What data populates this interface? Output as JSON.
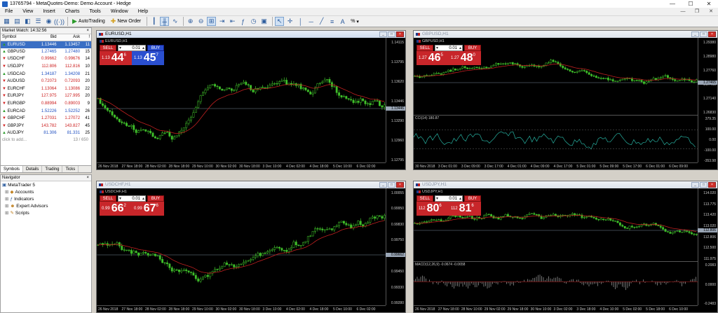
{
  "window": {
    "title": "13765794 - MetaQuotes-Demo: Demo Account - Hedge"
  },
  "menu": [
    "File",
    "View",
    "Insert",
    "Charts",
    "Tools",
    "Window",
    "Help"
  ],
  "toolbar": {
    "autotrading": "AutoTrading",
    "new_order": "New Order",
    "zoom_pct": "%"
  },
  "market_watch": {
    "title": "Market Watch: 14:32:56",
    "headers": [
      "Symbol",
      "Bid",
      "Ask",
      "!"
    ],
    "rows": [
      {
        "symbol": "EURUSD",
        "bid": "1.13446",
        "ask": "1.13457",
        "spread": "11",
        "dir": "up"
      },
      {
        "symbol": "GBPUSD",
        "bid": "1.27465",
        "ask": "1.27480",
        "spread": "15",
        "dir": "up"
      },
      {
        "symbol": "USDCHF",
        "bid": "0.99662",
        "ask": "0.99676",
        "spread": "14",
        "dir": "down"
      },
      {
        "symbol": "USDJPY",
        "bid": "112.806",
        "ask": "112.816",
        "spread": "10",
        "dir": "down"
      },
      {
        "symbol": "USDCAD",
        "bid": "1.34187",
        "ask": "1.34208",
        "spread": "21",
        "dir": "up"
      },
      {
        "symbol": "AUDUSD",
        "bid": "0.72073",
        "ask": "0.72093",
        "spread": "20",
        "dir": "down"
      },
      {
        "symbol": "EURCHF",
        "bid": "1.13064",
        "ask": "1.13086",
        "spread": "22",
        "dir": "down"
      },
      {
        "symbol": "EURJPY",
        "bid": "127.975",
        "ask": "127.995",
        "spread": "20",
        "dir": "down"
      },
      {
        "symbol": "EURGBP",
        "bid": "0.88994",
        "ask": "0.89003",
        "spread": "9",
        "dir": "down"
      },
      {
        "symbol": "EURCAD",
        "bid": "1.52226",
        "ask": "1.52252",
        "spread": "26",
        "dir": "up"
      },
      {
        "symbol": "GBPCHF",
        "bid": "1.27031",
        "ask": "1.27072",
        "spread": "41",
        "dir": "down"
      },
      {
        "symbol": "GBPJPY",
        "bid": "143.782",
        "ask": "143.827",
        "spread": "45",
        "dir": "down"
      },
      {
        "symbol": "AUDJPY",
        "bid": "81.306",
        "ask": "81.331",
        "spread": "25",
        "dir": "up"
      }
    ],
    "add_text": "click to add...",
    "count": "13 / 650",
    "tabs": [
      "Symbols",
      "Details",
      "Trading",
      "Ticks"
    ]
  },
  "navigator": {
    "title": "Navigator",
    "root": "MetaTrader 5",
    "items": [
      "Accounts",
      "Indicators",
      "Expert Advisors",
      "Scripts"
    ]
  },
  "charts": [
    {
      "title": "EURUSD,H1",
      "label": "EURUSD,H1",
      "active": true,
      "trade": {
        "sell": "SELL",
        "buy": "BUY",
        "volume": "0.01",
        "bid_pre": "1.13",
        "bid_big": "44",
        "bid_sup": "6",
        "ask_pre": "1.13",
        "ask_big": "45",
        "ask_sup": "7",
        "buy_red": false
      },
      "yticks": [
        "1.14115",
        "1.13795",
        "1.13620",
        "1.13446",
        "1.13290",
        "1.12960",
        "1.12795"
      ],
      "current": "1.13446",
      "xticks": [
        "26 Nov 2018",
        "27 Nov 18:00",
        "28 Nov 02:00",
        "28 Nov 18:00",
        "29 Nov 10:00",
        "30 Nov 02:00",
        "30 Nov 18:00",
        "3 Dec 10:00",
        "4 Dec 02:00",
        "4 Dec 18:00",
        "5 Dec 10:00",
        "6 Dec 02:00"
      ]
    },
    {
      "title": "GBPUSD,H1",
      "label": "GBPUSD,H1",
      "active": false,
      "trade": {
        "sell": "SELL",
        "buy": "BUY",
        "volume": "0.01",
        "bid_pre": "1.27",
        "bid_big": "46",
        "bid_sup": "5",
        "ask_pre": "1.27",
        "ask_big": "48",
        "ask_sup": "0",
        "buy_red": true
      },
      "yticks": [
        "1.29380",
        "1.28980",
        "1.27760",
        "1.27465",
        "1.27140",
        "1.26830"
      ],
      "current": "1.27465",
      "indicator": "CCI(14) 180.87",
      "indticks": [
        "379.35",
        "100.00",
        "0.00",
        "-100.00",
        "-353.98"
      ],
      "xticks": [
        "30 Nov 2018",
        "3 Dec 01:00",
        "3 Dec 09:00",
        "3 Dec 17:00",
        "4 Dec 01:00",
        "4 Dec 09:00",
        "4 Dec 17:00",
        "5 Dec 01:00",
        "5 Dec 09:00",
        "5 Dec 17:00",
        "6 Dec 01:00",
        "6 Dec 09:00"
      ]
    },
    {
      "title": "USDCHF,H1",
      "label": "USDCHF,H1",
      "active": false,
      "trade": {
        "sell": "SELL",
        "buy": "BUY",
        "volume": "0.01",
        "bid_pre": "0.99",
        "bid_big": "66",
        "bid_sup": "2",
        "ask_pre": "0.99",
        "ask_big": "67",
        "ask_sup": "6",
        "buy_red": true
      },
      "yticks": [
        "1.00055",
        "0.99950",
        "0.99830",
        "0.99750",
        "0.99662",
        "0.99450",
        "0.99330",
        "0.99280"
      ],
      "current": "0.99662",
      "xticks": [
        "26 Nov 2018",
        "27 Nov 18:00",
        "28 Nov 02:00",
        "28 Nov 18:00",
        "29 Nov 10:00",
        "30 Nov 02:00",
        "30 Nov 18:00",
        "3 Dec 10:00",
        "4 Dec 02:00",
        "4 Dec 18:00",
        "5 Dec 10:00",
        "6 Dec 02:00"
      ]
    },
    {
      "title": "USDJPY,H1",
      "label": "USDJPY,H1",
      "active": false,
      "trade": {
        "sell": "SELL",
        "buy": "BUY",
        "volume": "0.01",
        "bid_pre": "112",
        "bid_big": "80",
        "bid_sup": "6",
        "ask_pre": "112",
        "ask_big": "81",
        "ask_sup": "6",
        "buy_red": true
      },
      "yticks": [
        "114.020",
        "113.775",
        "113.420",
        "113.020",
        "112.806",
        "112.500",
        "111.975"
      ],
      "current": "112.806",
      "indicator": "MACD(12,26,9) -0.0674 -0.0658",
      "indticks": [
        "0.2083",
        "0.0000",
        "-0.2483"
      ],
      "xticks": [
        "26 Nov 2018",
        "27 Nov 18:00",
        "28 Nov 10:00",
        "29 Nov 02:00",
        "29 Nov 18:00",
        "30 Nov 10:00",
        "3 Dec 02:00",
        "3 Dec 18:00",
        "4 Dec 10:00",
        "5 Dec 02:00",
        "5 Dec 18:00",
        "6 Dec 10:00"
      ]
    }
  ]
}
